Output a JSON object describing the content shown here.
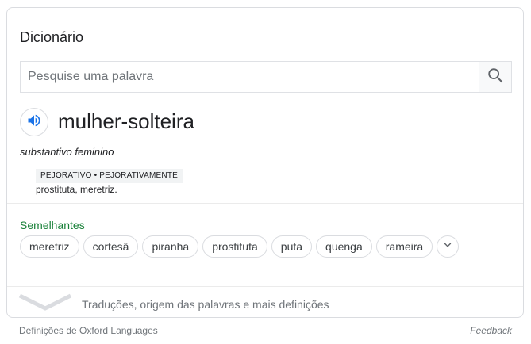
{
  "card": {
    "title": "Dicionário",
    "search": {
      "placeholder": "Pesquise uma palavra",
      "value": "",
      "button_icon": "search-icon"
    },
    "entry": {
      "speaker_icon": "speaker-icon",
      "word": "mulher-solteira",
      "part_of_speech": "substantivo feminino",
      "tag": "PEJORATIVO • PEJORATIVAMENTE",
      "definition": "prostituta, meretriz."
    },
    "similar": {
      "label": "Semelhantes",
      "words": [
        "meretriz",
        "cortesã",
        "piranha",
        "prostituta",
        "puta",
        "quenga",
        "rameira"
      ],
      "more_icon": "chevron-down-icon"
    },
    "expand": {
      "icon": "chevron-down-icon",
      "text": "Traduções, origem das palavras e mais definições"
    }
  },
  "footer": {
    "source": "Definições de Oxford Languages",
    "feedback": "Feedback"
  },
  "colors": {
    "accent_blue": "#1a73e8",
    "similar_green": "#188038",
    "muted_text": "#70757a",
    "border": "#dadce0"
  }
}
